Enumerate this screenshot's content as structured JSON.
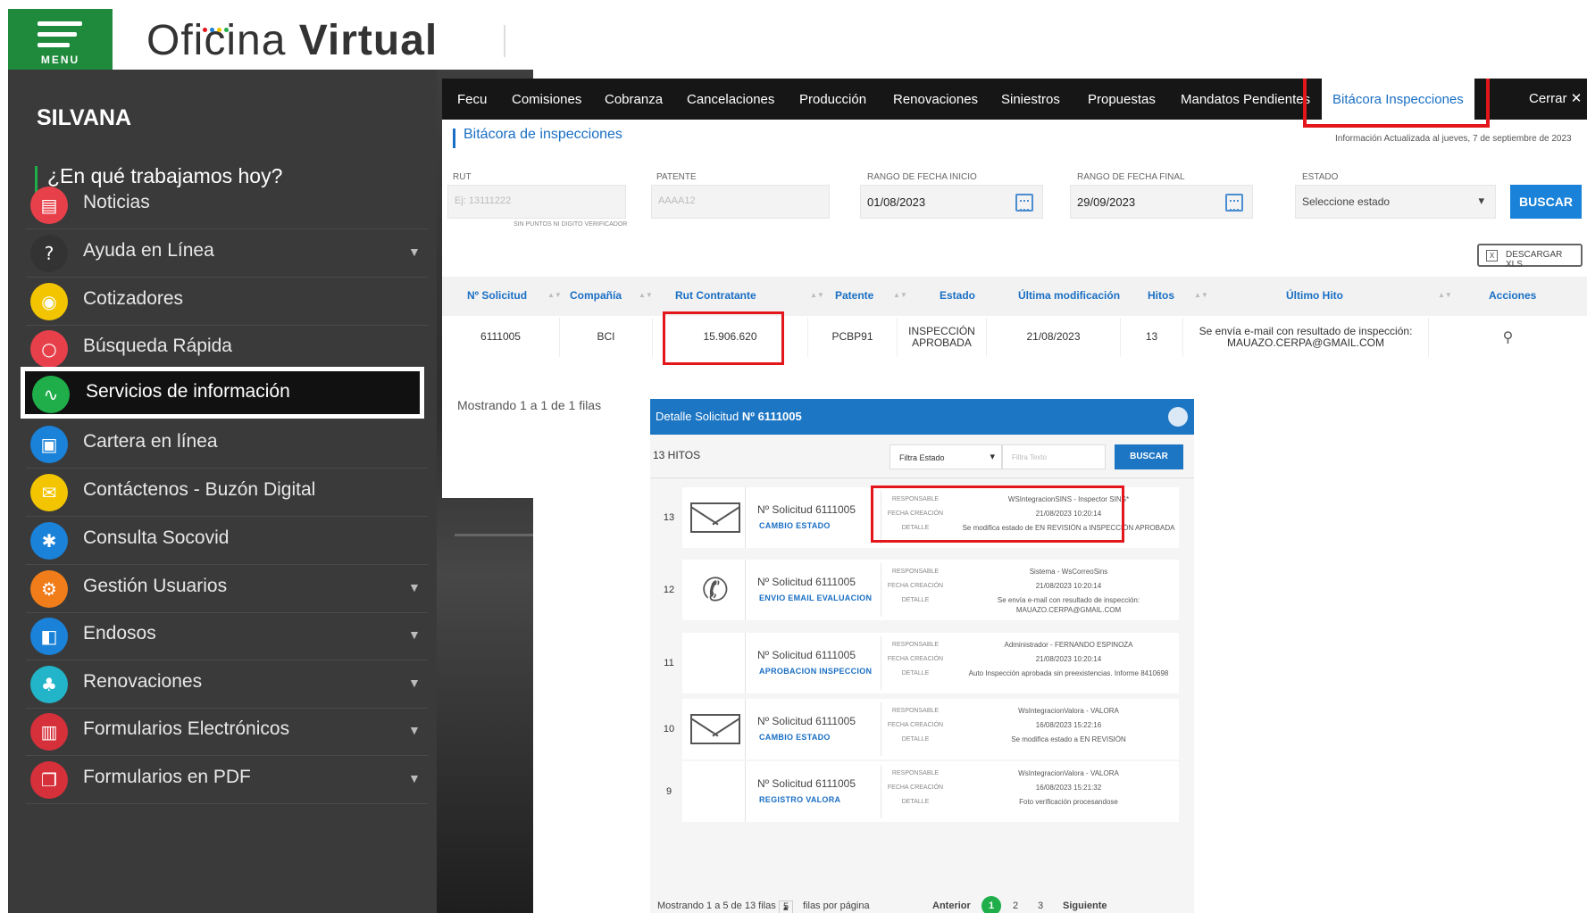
{
  "brand": {
    "menu_label": "MENU",
    "name_light": "Oficina ",
    "name_bold": "Virtual"
  },
  "sidebar": {
    "user": "SILVANA",
    "greeting": "¿En qué trabajamos hoy?",
    "items": [
      {
        "label": "Noticias",
        "icon": "newspaper-icon",
        "color": "#e8404a",
        "glyph": "▤",
        "expandable": false
      },
      {
        "label": "Ayuda en Línea",
        "icon": "help-icon",
        "color": "#333333",
        "glyph": "?",
        "expandable": true
      },
      {
        "label": "Cotizadores",
        "icon": "eye-icon",
        "color": "#f2c500",
        "glyph": "◉",
        "expandable": false
      },
      {
        "label": "Búsqueda Rápida",
        "icon": "search-icon",
        "color": "#e8404a",
        "glyph": "○",
        "expandable": false
      },
      {
        "label": "Servicios de información",
        "icon": "chart-icon",
        "color": "#1fae4a",
        "glyph": "∿",
        "expandable": false,
        "active": true
      },
      {
        "label": "Cartera en línea",
        "icon": "briefcase-icon",
        "color": "#1a82d9",
        "glyph": "▣",
        "expandable": false
      },
      {
        "label": "Contáctenos - Buzón Digital",
        "icon": "mail-icon",
        "color": "#f2c500",
        "glyph": "✉",
        "expandable": false
      },
      {
        "label": "Consulta Socovid",
        "icon": "virus-icon",
        "color": "#1a82d9",
        "glyph": "✱",
        "expandable": false
      },
      {
        "label": "Gestión Usuarios",
        "icon": "gear-icon",
        "color": "#f07d1a",
        "glyph": "⚙",
        "expandable": true
      },
      {
        "label": "Endosos",
        "icon": "document-icon",
        "color": "#1a82d9",
        "glyph": "◧",
        "expandable": true
      },
      {
        "label": "Renovaciones",
        "icon": "users-icon",
        "color": "#22b5c9",
        "glyph": "♣",
        "expandable": true
      },
      {
        "label": "Formularios Electrónicos",
        "icon": "form-icon",
        "color": "#d6303a",
        "glyph": "▥",
        "expandable": true
      },
      {
        "label": "Formularios en PDF",
        "icon": "pdf-icon",
        "color": "#d6303a",
        "glyph": "❐",
        "expandable": true
      }
    ]
  },
  "nav": {
    "tabs": [
      "Fecu",
      "Comisiones",
      "Cobranza",
      "Cancelaciones",
      "Producción",
      "Renovaciones",
      "Siniestros",
      "Propuestas",
      "Mandatos Pendientes",
      "Bitácora Inspecciones"
    ],
    "active_tab": "Bitácora Inspecciones",
    "close_label": "Cerrar"
  },
  "page": {
    "title": "Bitácora de inspecciones",
    "info": "Información Actualizada al jueves, 7 de septiembre de 2023"
  },
  "filters": {
    "rut": {
      "label": "RUT",
      "placeholder": "Ej: 13111222",
      "hint": "SIN PUNTOS NI DIGITO VERIFICADOR"
    },
    "patente": {
      "label": "PATENTE",
      "placeholder": "AAAA12"
    },
    "fecha_inicio": {
      "label": "RANGO DE FECHA INICIO",
      "value": "01/08/2023"
    },
    "fecha_final": {
      "label": "RANGO DE FECHA FINAL",
      "value": "29/09/2023"
    },
    "estado": {
      "label": "ESTADO",
      "value": "Seleccione estado"
    },
    "search_label": "BUSCAR",
    "download_label": "DESCARGAR XLS"
  },
  "table": {
    "headers": [
      "Nº Solicitud",
      "Compañía",
      "Rut Contratante",
      "Patente",
      "Estado",
      "Última modificación",
      "Hitos",
      "Último Hito",
      "Acciones"
    ],
    "row": {
      "solicitud": "6111005",
      "compania": "BCI",
      "rut": "15.906.620",
      "patente": "PCBP91",
      "estado": "INSPECCIÓN APROBADA",
      "ultima_mod": "21/08/2023",
      "hitos": "13",
      "ultimo_hito": "Se envía e-mail con resultado de inspección: MAUAZO.CERPA@GMAIL.COM"
    },
    "showing": "Mostrando 1 a 1 de 1 filas"
  },
  "modal": {
    "title_prefix": "Detalle Solicitud ",
    "title_number": "Nº 6111005",
    "hitos_count": "13 HITOS",
    "filter_estado": "Filtra Estado",
    "filter_text_placeholder": "Filtra Texto",
    "search_label": "BUSCAR",
    "key_labels": {
      "responsable": "RESPONSABLE",
      "fecha": "FECHA CREACIÓN",
      "detalle": "DETALLE"
    },
    "hitos": [
      {
        "num": "13",
        "icon": "envelope-icon",
        "solicitud": "Nº Solicitud 6111005",
        "type": "CAMBIO ESTADO",
        "responsable": "WSIntegracionSINS - Inspector SINS*",
        "fecha": "21/08/2023 10:20:14",
        "detalle": "Se modifica estado de EN REVISIÓN a INSPECCIÓN APROBADA"
      },
      {
        "num": "12",
        "icon": "phone-icon",
        "solicitud": "Nº Solicitud 6111005",
        "type": "ENVIO EMAIL EVALUACION",
        "responsable": "Sistema - WsCorreoSins",
        "fecha": "21/08/2023 10:20:14",
        "detalle": "Se envía e-mail con resultado de inspección: MAUAZO.CERPA@GMAIL.COM"
      },
      {
        "num": "11",
        "icon": "",
        "solicitud": "Nº Solicitud 6111005",
        "type": "APROBACION INSPECCION",
        "responsable": "Administrador - FERNANDO ESPINOZA",
        "fecha": "21/08/2023 10:20:14",
        "detalle": "Auto Inspección aprobada sin preexistencias. Informe 8410698"
      },
      {
        "num": "10",
        "icon": "envelope-icon",
        "solicitud": "Nº Solicitud 6111005",
        "type": "CAMBIO ESTADO",
        "responsable": "WsIntegracionValora - VALORA",
        "fecha": "16/08/2023 15:22:16",
        "detalle": "Se modifica estado a EN REVISIÓN"
      },
      {
        "num": "9",
        "icon": "",
        "solicitud": "Nº Solicitud 6111005",
        "type": "REGISTRO VALORA",
        "responsable": "WsIntegracionValora - VALORA",
        "fecha": "16/08/2023 15:21:32",
        "detalle": "Foto verificación procesandose"
      }
    ],
    "footer": {
      "showing": "Mostrando 1 a 5 de 13 filas",
      "page_size": "5",
      "per_page": "filas por página",
      "prev": "Anterior",
      "pages": [
        "1",
        "2",
        "3"
      ],
      "next": "Siguiente"
    }
  }
}
